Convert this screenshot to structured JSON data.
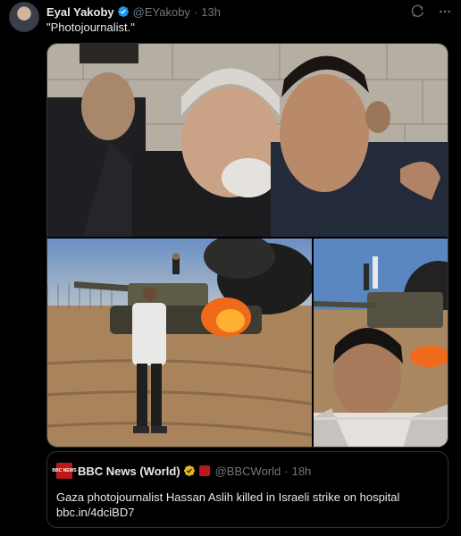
{
  "tweet": {
    "author_name": "Eyal Yakoby",
    "handle": "@EYakoby",
    "separator": "·",
    "time": "13h",
    "text": "\"Photojournalist.\"",
    "icons": [
      "grok-icon",
      "more-icon"
    ]
  },
  "media": {
    "count": 3,
    "items": [
      "photo",
      "photo",
      "photo"
    ]
  },
  "quoted": {
    "logo_text": "BBC NEWS",
    "author_name": "BBC News (World)",
    "handle": "@BBCWorld",
    "separator": "·",
    "time": "18h",
    "text_line1": "Gaza photojournalist Hassan Aslih killed in Israeli strike on hospital",
    "text_line2": "bbc.in/4dciBD7"
  },
  "colors": {
    "background": "#000000",
    "text": "#e7e9ea",
    "muted": "#71767b",
    "border": "#2f3336",
    "verified_blue": "#1d9bf0",
    "verified_gold": "#e2b719",
    "bbc_red": "#bb1919"
  }
}
